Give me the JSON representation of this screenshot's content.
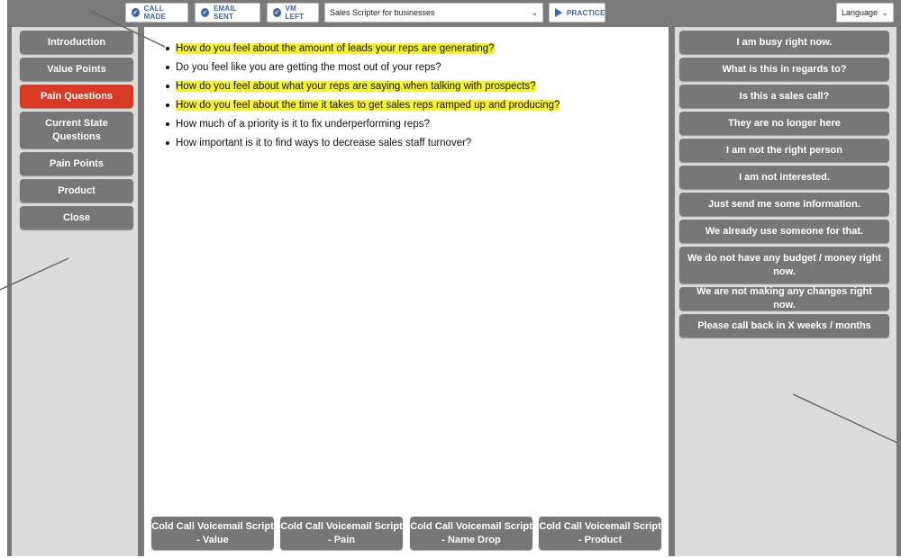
{
  "toolbar": {
    "call_made": "CALL MADE",
    "email_sent": "EMAIL SENT",
    "vm_left": "VM LEFT",
    "script_select": "Sales Scripter for businesses",
    "practice": "PRACTICE",
    "language_select": "Language"
  },
  "sidebar": {
    "items": [
      {
        "label": "Introduction",
        "active": false
      },
      {
        "label": "Value Points",
        "active": false
      },
      {
        "label": "Pain Questions",
        "active": true
      },
      {
        "label": "Current State Questions",
        "active": false
      },
      {
        "label": "Pain Points",
        "active": false
      },
      {
        "label": "Product",
        "active": false
      },
      {
        "label": "Close",
        "active": false
      }
    ]
  },
  "questions": [
    {
      "text": "How do you feel about the amount of leads your reps are generating?",
      "highlighted": true
    },
    {
      "text": "Do you feel like you are getting the most out of your reps?",
      "highlighted": false
    },
    {
      "text": "How do you feel about what your reps are saying when talking with prospects?",
      "highlighted": true
    },
    {
      "text": "How do you feel about the time it takes to get sales reps ramped up and producing?",
      "highlighted": true
    },
    {
      "text": "How much of a priority is it to fix underperforming reps?",
      "highlighted": false
    },
    {
      "text": "How important is it to find ways to decrease sales staff turnover?",
      "highlighted": false
    }
  ],
  "voicemail_scripts": [
    {
      "line1": "Cold Call Voicemail Script",
      "line2": "- Value"
    },
    {
      "line1": "Cold Call Voicemail Script",
      "line2": "- Pain"
    },
    {
      "line1": "Cold Call Voicemail Script",
      "line2": "- Name Drop"
    },
    {
      "line1": "Cold Call Voicemail Script",
      "line2": "- Product"
    }
  ],
  "objections": [
    "I am busy right now.",
    "What is this in regards to?",
    "Is this a sales call?",
    "They are no longer here",
    "I am not the right person",
    "I am not interested.",
    "Just send me some information.",
    "We already use someone for that.",
    "We do not have any budget / money right now.",
    "We are not making any changes right now.",
    "Please call back in X weeks / months"
  ],
  "colors": {
    "frame": "#7a7a7a",
    "panel": "#dcdcdc",
    "button": "#777777",
    "active_button": "#d93a26",
    "highlight": "#f6f32a",
    "toolbar_accent": "#3a66a8"
  },
  "icons": {
    "call_made": "check-circle-icon",
    "email_sent": "check-circle-icon",
    "vm_left": "check-circle-icon",
    "practice": "play-icon",
    "dropdown": "chevron-down-icon"
  }
}
